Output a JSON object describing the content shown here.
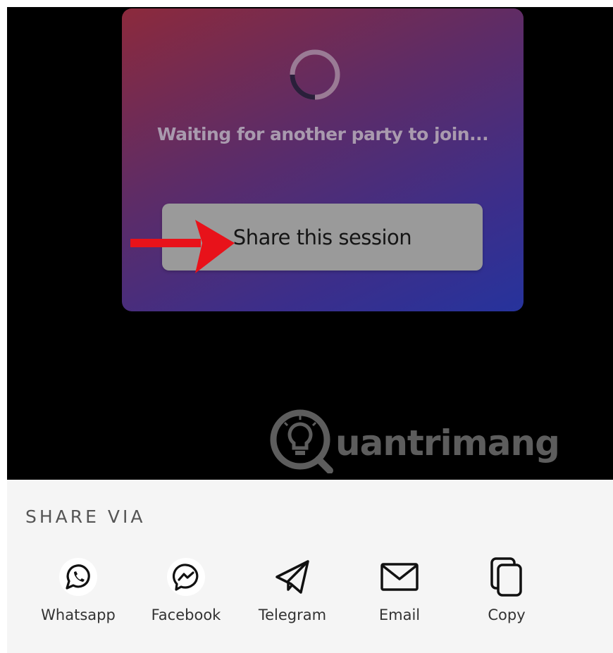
{
  "session_card": {
    "status_text": "Waiting for another party to join...",
    "share_button_label": "Share this session"
  },
  "watermark": {
    "text": "uantrimang",
    "logo": "lightbulb-q-icon"
  },
  "share_sheet": {
    "title": "SHARE VIA",
    "options": [
      {
        "label": "Whatsapp",
        "icon": "whatsapp-icon"
      },
      {
        "label": "Facebook",
        "icon": "messenger-icon"
      },
      {
        "label": "Telegram",
        "icon": "telegram-icon"
      },
      {
        "label": "Email",
        "icon": "email-icon"
      },
      {
        "label": "Copy",
        "icon": "copy-icon"
      }
    ]
  },
  "colors": {
    "card_gradient_start": "#8c2a3c",
    "card_gradient_end": "#26339c",
    "share_button_bg": "#9a9a9a",
    "annotation_arrow": "#e8121a",
    "sheet_bg": "#f5f5f5"
  }
}
